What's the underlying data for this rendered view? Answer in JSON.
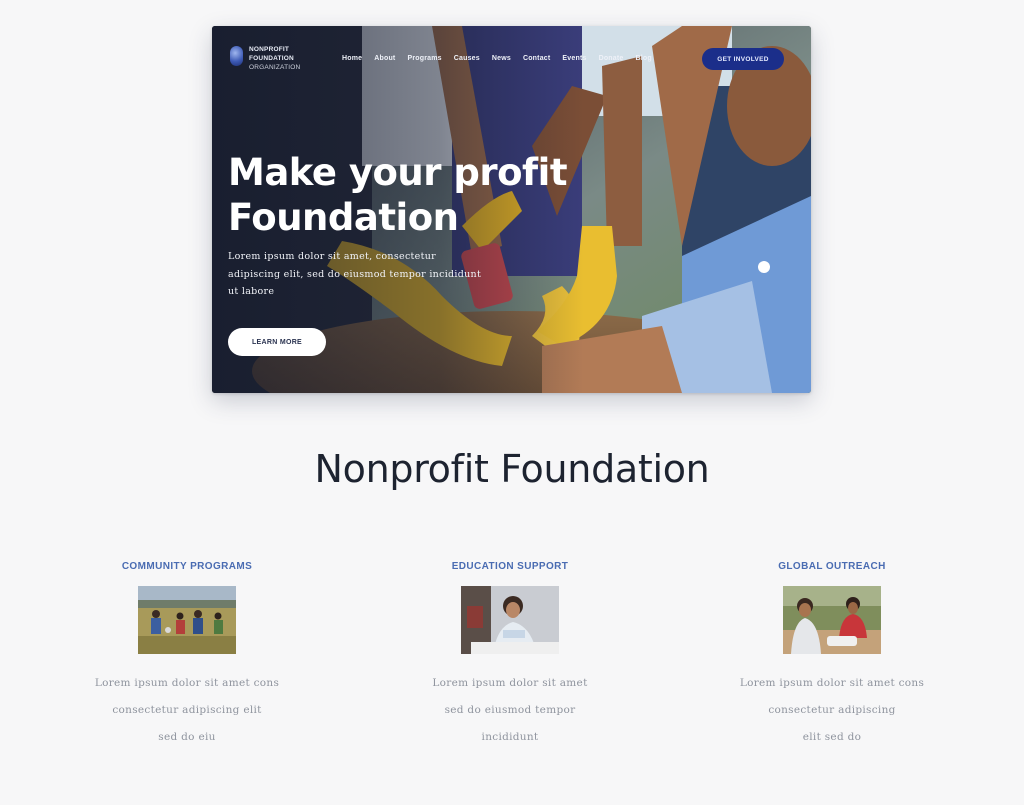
{
  "hero": {
    "logo": {
      "icon": "globe-icon",
      "line1": "NONPROFIT",
      "line2": "FOUNDATION",
      "line3": "ORGANIZATION"
    },
    "nav": [
      "Home",
      "About",
      "Programs",
      "Causes",
      "News",
      "Contact",
      "Events",
      "Donate",
      "Blog"
    ],
    "cta_label": "GET INVOLVED",
    "title": "Make your profit Foundation",
    "description": "Lorem ipsum dolor sit amet, consectetur adipiscing elit, sed do eiusmod tempor incididunt ut labore",
    "button_label": "LEARN MORE"
  },
  "section": {
    "title": "Nonprofit Foundation"
  },
  "features": [
    {
      "title": "COMMUNITY PROGRAMS",
      "photo": "children-on-field-photo",
      "lines": [
        "Lorem ipsum dolor sit amet cons",
        "consectetur adipiscing elit",
        "sed do eiu"
      ]
    },
    {
      "title": "EDUCATION SUPPORT",
      "photo": "volunteer-at-desk-photo",
      "lines": [
        "Lorem ipsum dolor sit amet",
        "sed do eiusmod tempor",
        "incididunt"
      ]
    },
    {
      "title": "GLOBAL OUTREACH",
      "photo": "people-outdoors-photo",
      "lines": [
        "Lorem ipsum dolor sit amet cons",
        "consectetur adipiscing",
        "elit sed do"
      ]
    }
  ],
  "colors": {
    "page_background": "#f7f7f8",
    "accent_blue": "#1b2e8a",
    "feature_title": "#4a6cb2",
    "body_text_muted": "#8f949e",
    "glove_yellow": "#e8b92a"
  }
}
